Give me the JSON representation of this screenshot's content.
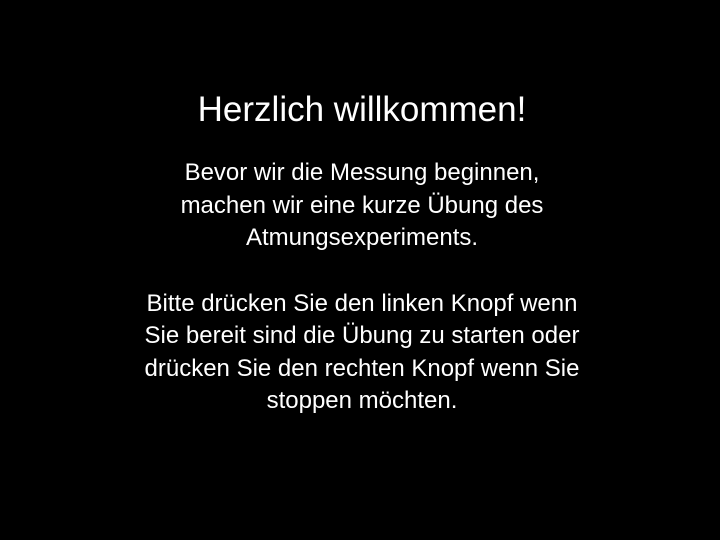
{
  "screen": {
    "background_color": "#000000",
    "text_color": "#ffffff",
    "title": "Herzlich willkommen!",
    "intro_lines": [
      "Bevor wir die Messung beginnen,",
      "machen wir eine kurze Übung des",
      "Atmungsexperiments."
    ],
    "instruction_lines": [
      "Bitte drücken Sie den linken Knopf wenn",
      "Sie bereit sind die Übung zu starten oder",
      "drücken Sie den rechten Knopf wenn Sie",
      "stoppen möchten."
    ]
  }
}
